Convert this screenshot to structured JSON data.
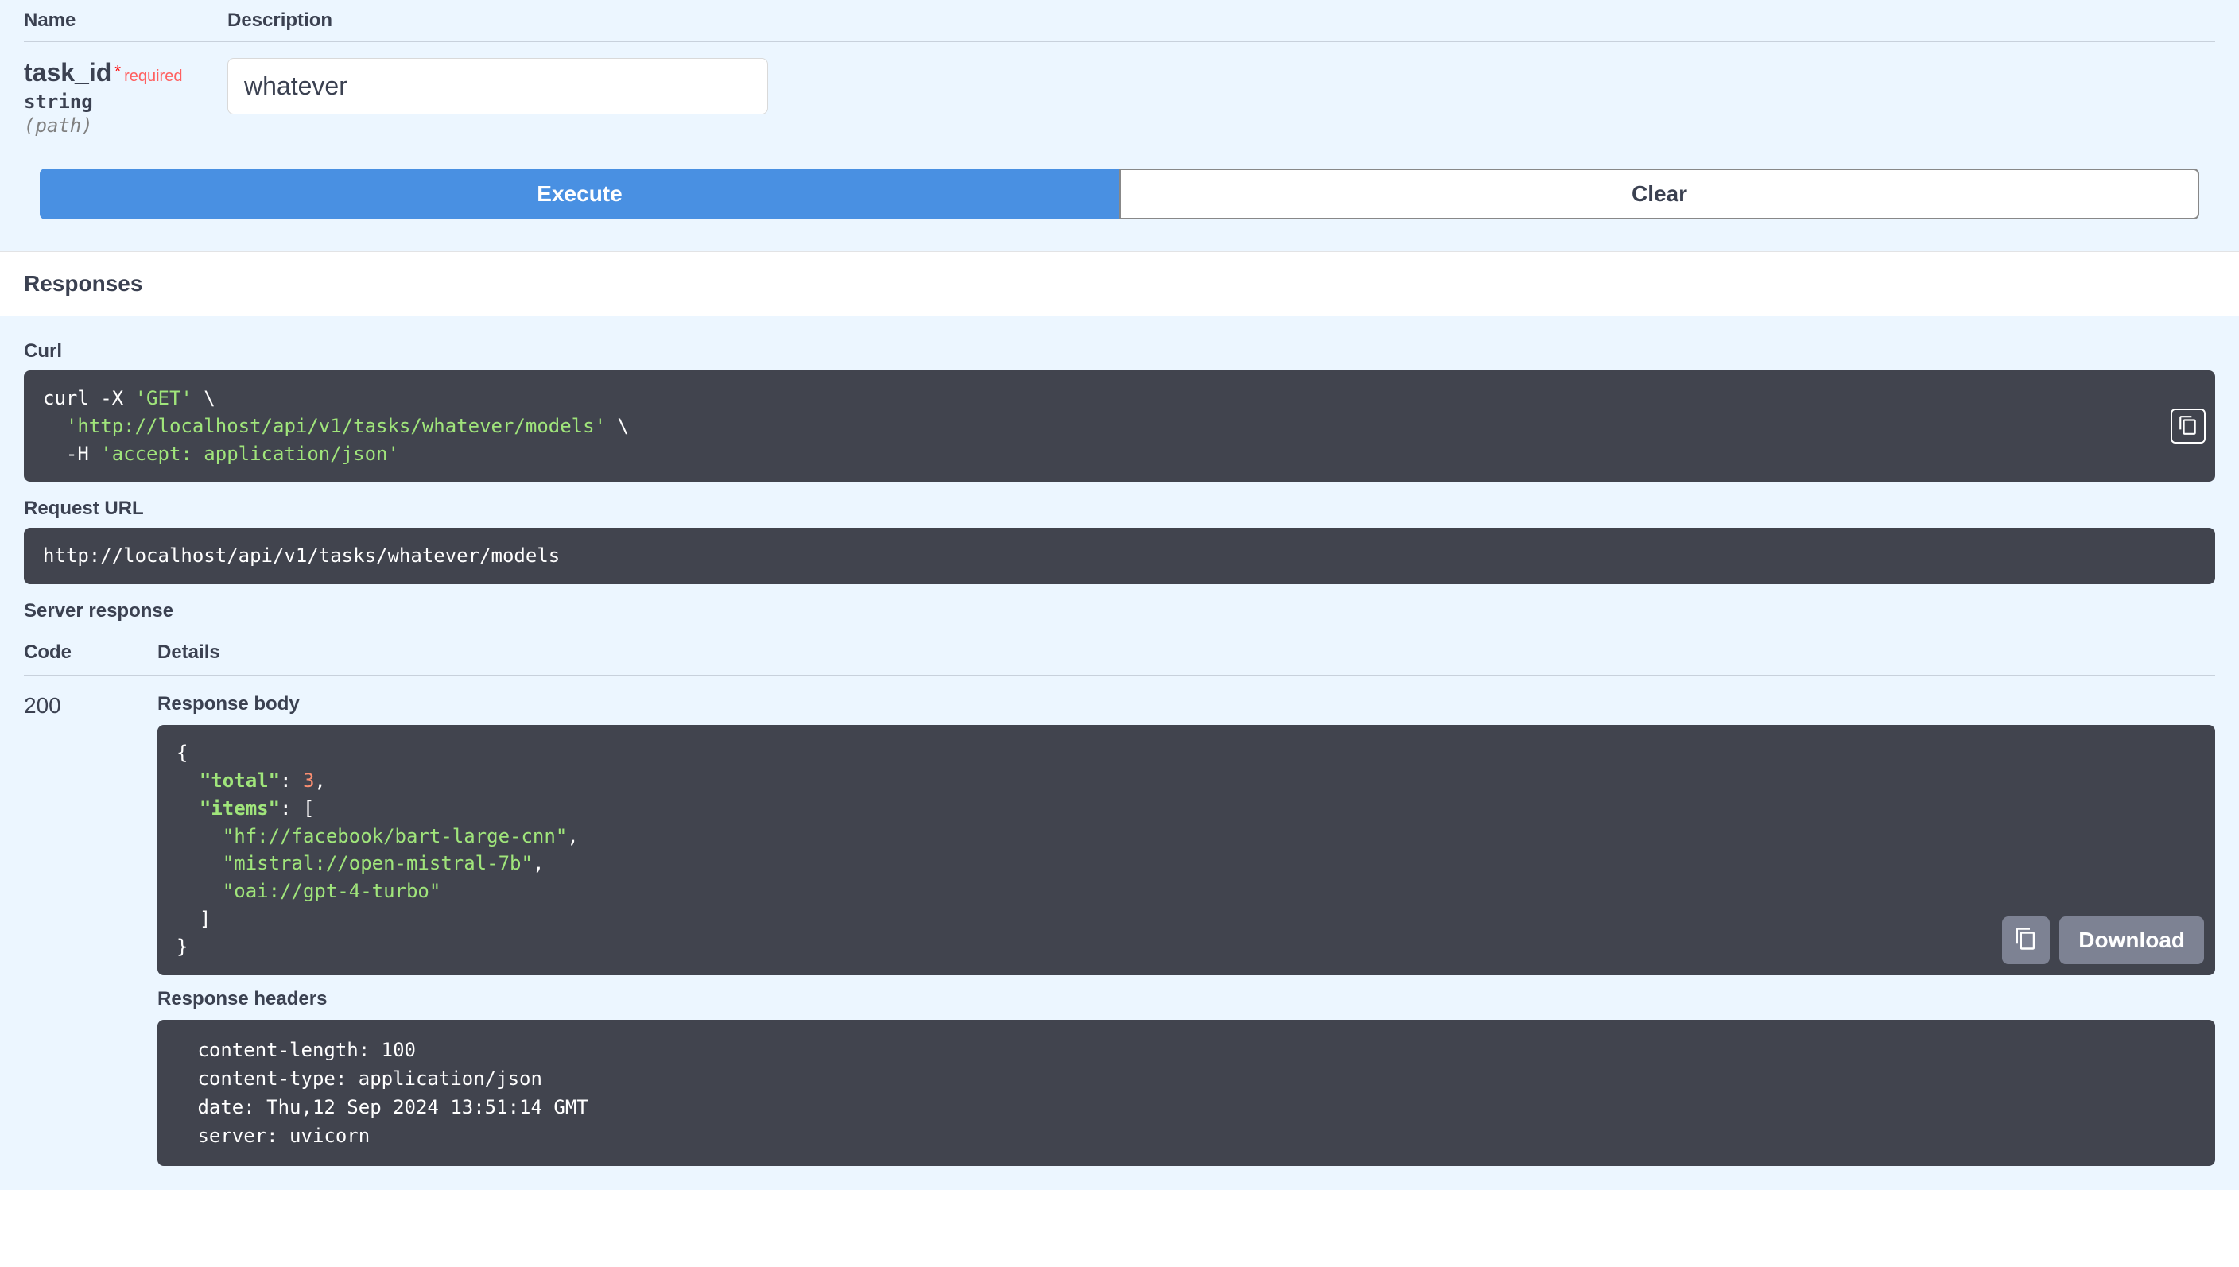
{
  "param_headers": {
    "name": "Name",
    "description": "Description"
  },
  "parameter": {
    "name": "task_id",
    "required_star": "*",
    "required_text": "required",
    "type": "string",
    "in": "(path)",
    "value": "whatever"
  },
  "buttons": {
    "execute": "Execute",
    "clear": "Clear"
  },
  "responses_title": "Responses",
  "curl": {
    "label": "Curl",
    "line1_cmd": "curl -X ",
    "line1_str": "'GET'",
    "line1_cont": " \\",
    "line2_str": "'http://localhost/api/v1/tasks/whatever/models'",
    "line2_cont": " \\",
    "line3_cmd": "  -H ",
    "line3_str": "'accept: application/json'"
  },
  "request_url": {
    "label": "Request URL",
    "value": "http://localhost/api/v1/tasks/whatever/models"
  },
  "server_response": {
    "label": "Server response",
    "code_header": "Code",
    "details_header": "Details",
    "code": "200",
    "body_label": "Response body",
    "body": {
      "l1": "{",
      "l2_indent": "  ",
      "l2_key": "\"total\"",
      "l2_colon": ": ",
      "l2_val": "3",
      "l2_comma": ",",
      "l3_indent": "  ",
      "l3_key": "\"items\"",
      "l3_rest": ": [",
      "l4_indent": "    ",
      "l4_val": "\"hf://facebook/bart-large-cnn\"",
      "l4_comma": ",",
      "l5_indent": "    ",
      "l5_val": "\"mistral://open-mistral-7b\"",
      "l5_comma": ",",
      "l6_indent": "    ",
      "l6_val": "\"oai://gpt-4-turbo\"",
      "l7": "  ]",
      "l8": "}"
    },
    "download": "Download",
    "headers_label": "Response headers",
    "headers_text": " content-length: 100 \n content-type: application/json \n date: Thu,12 Sep 2024 13:51:14 GMT \n server: uvicorn "
  }
}
